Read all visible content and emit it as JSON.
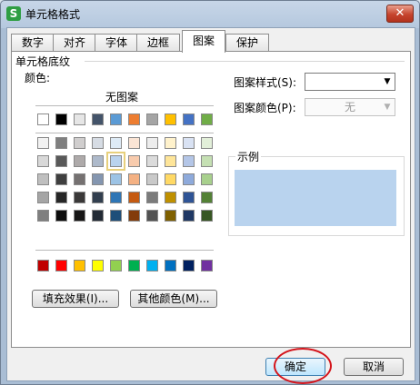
{
  "window": {
    "title": "单元格格式",
    "app_icon": "S",
    "close_label": "✕"
  },
  "tabs": [
    "数字",
    "对齐",
    "字体",
    "边框",
    "图案",
    "保护"
  ],
  "active_tab": "图案",
  "shading": {
    "group_title": "单元格底纹",
    "color_label": "颜色:",
    "no_pattern_label": "无图案",
    "selected_color": "#b9d3ee",
    "palette_top": [
      "#ffffff",
      "#000000",
      "#e6e6e6",
      "#44546a",
      "#5b9bd5",
      "#ed7d31",
      "#a5a5a5",
      "#ffc000",
      "#4472c4",
      "#70ad47"
    ],
    "palette_grid": [
      [
        "#f2f2f2",
        "#7f7f7f",
        "#d0cece",
        "#d6dce4",
        "#deebf6",
        "#fbe5d5",
        "#ededed",
        "#fff2cc",
        "#d9e2f3",
        "#e2efd9"
      ],
      [
        "#d8d8d8",
        "#595959",
        "#aeaaaa",
        "#adb9ca",
        "#b9d3ee",
        "#f8cbad",
        "#dbdbdb",
        "#fee599",
        "#b4c6e7",
        "#c5e0b3"
      ],
      [
        "#bfbfbf",
        "#3f3f3f",
        "#757171",
        "#8496b0",
        "#9cc3e5",
        "#f4b183",
        "#c9c9c9",
        "#ffd965",
        "#8eaadb",
        "#a8d08d"
      ],
      [
        "#a5a5a5",
        "#262626",
        "#3a3838",
        "#323f4f",
        "#2e75b5",
        "#c55a11",
        "#7b7b7b",
        "#bf9000",
        "#2f5496",
        "#538135"
      ],
      [
        "#7f7f7f",
        "#0c0c0c",
        "#171616",
        "#222a35",
        "#1e4e79",
        "#833c0b",
        "#525252",
        "#7f6000",
        "#1f3864",
        "#375623"
      ]
    ],
    "palette_standard": [
      "#c00000",
      "#ff0000",
      "#ffc000",
      "#ffff00",
      "#92d050",
      "#00b050",
      "#00b0f0",
      "#0070c0",
      "#002060",
      "#7030a0"
    ],
    "fill_effects_label": "填充效果(I)...",
    "more_colors_label": "其他颜色(M)..."
  },
  "pattern": {
    "style_label": "图案样式(S):",
    "style_value": "",
    "color_label": "图案颜色(P):",
    "color_value": "无",
    "sample_label": "示例"
  },
  "footer": {
    "ok_label": "确定",
    "cancel_label": "取消"
  }
}
